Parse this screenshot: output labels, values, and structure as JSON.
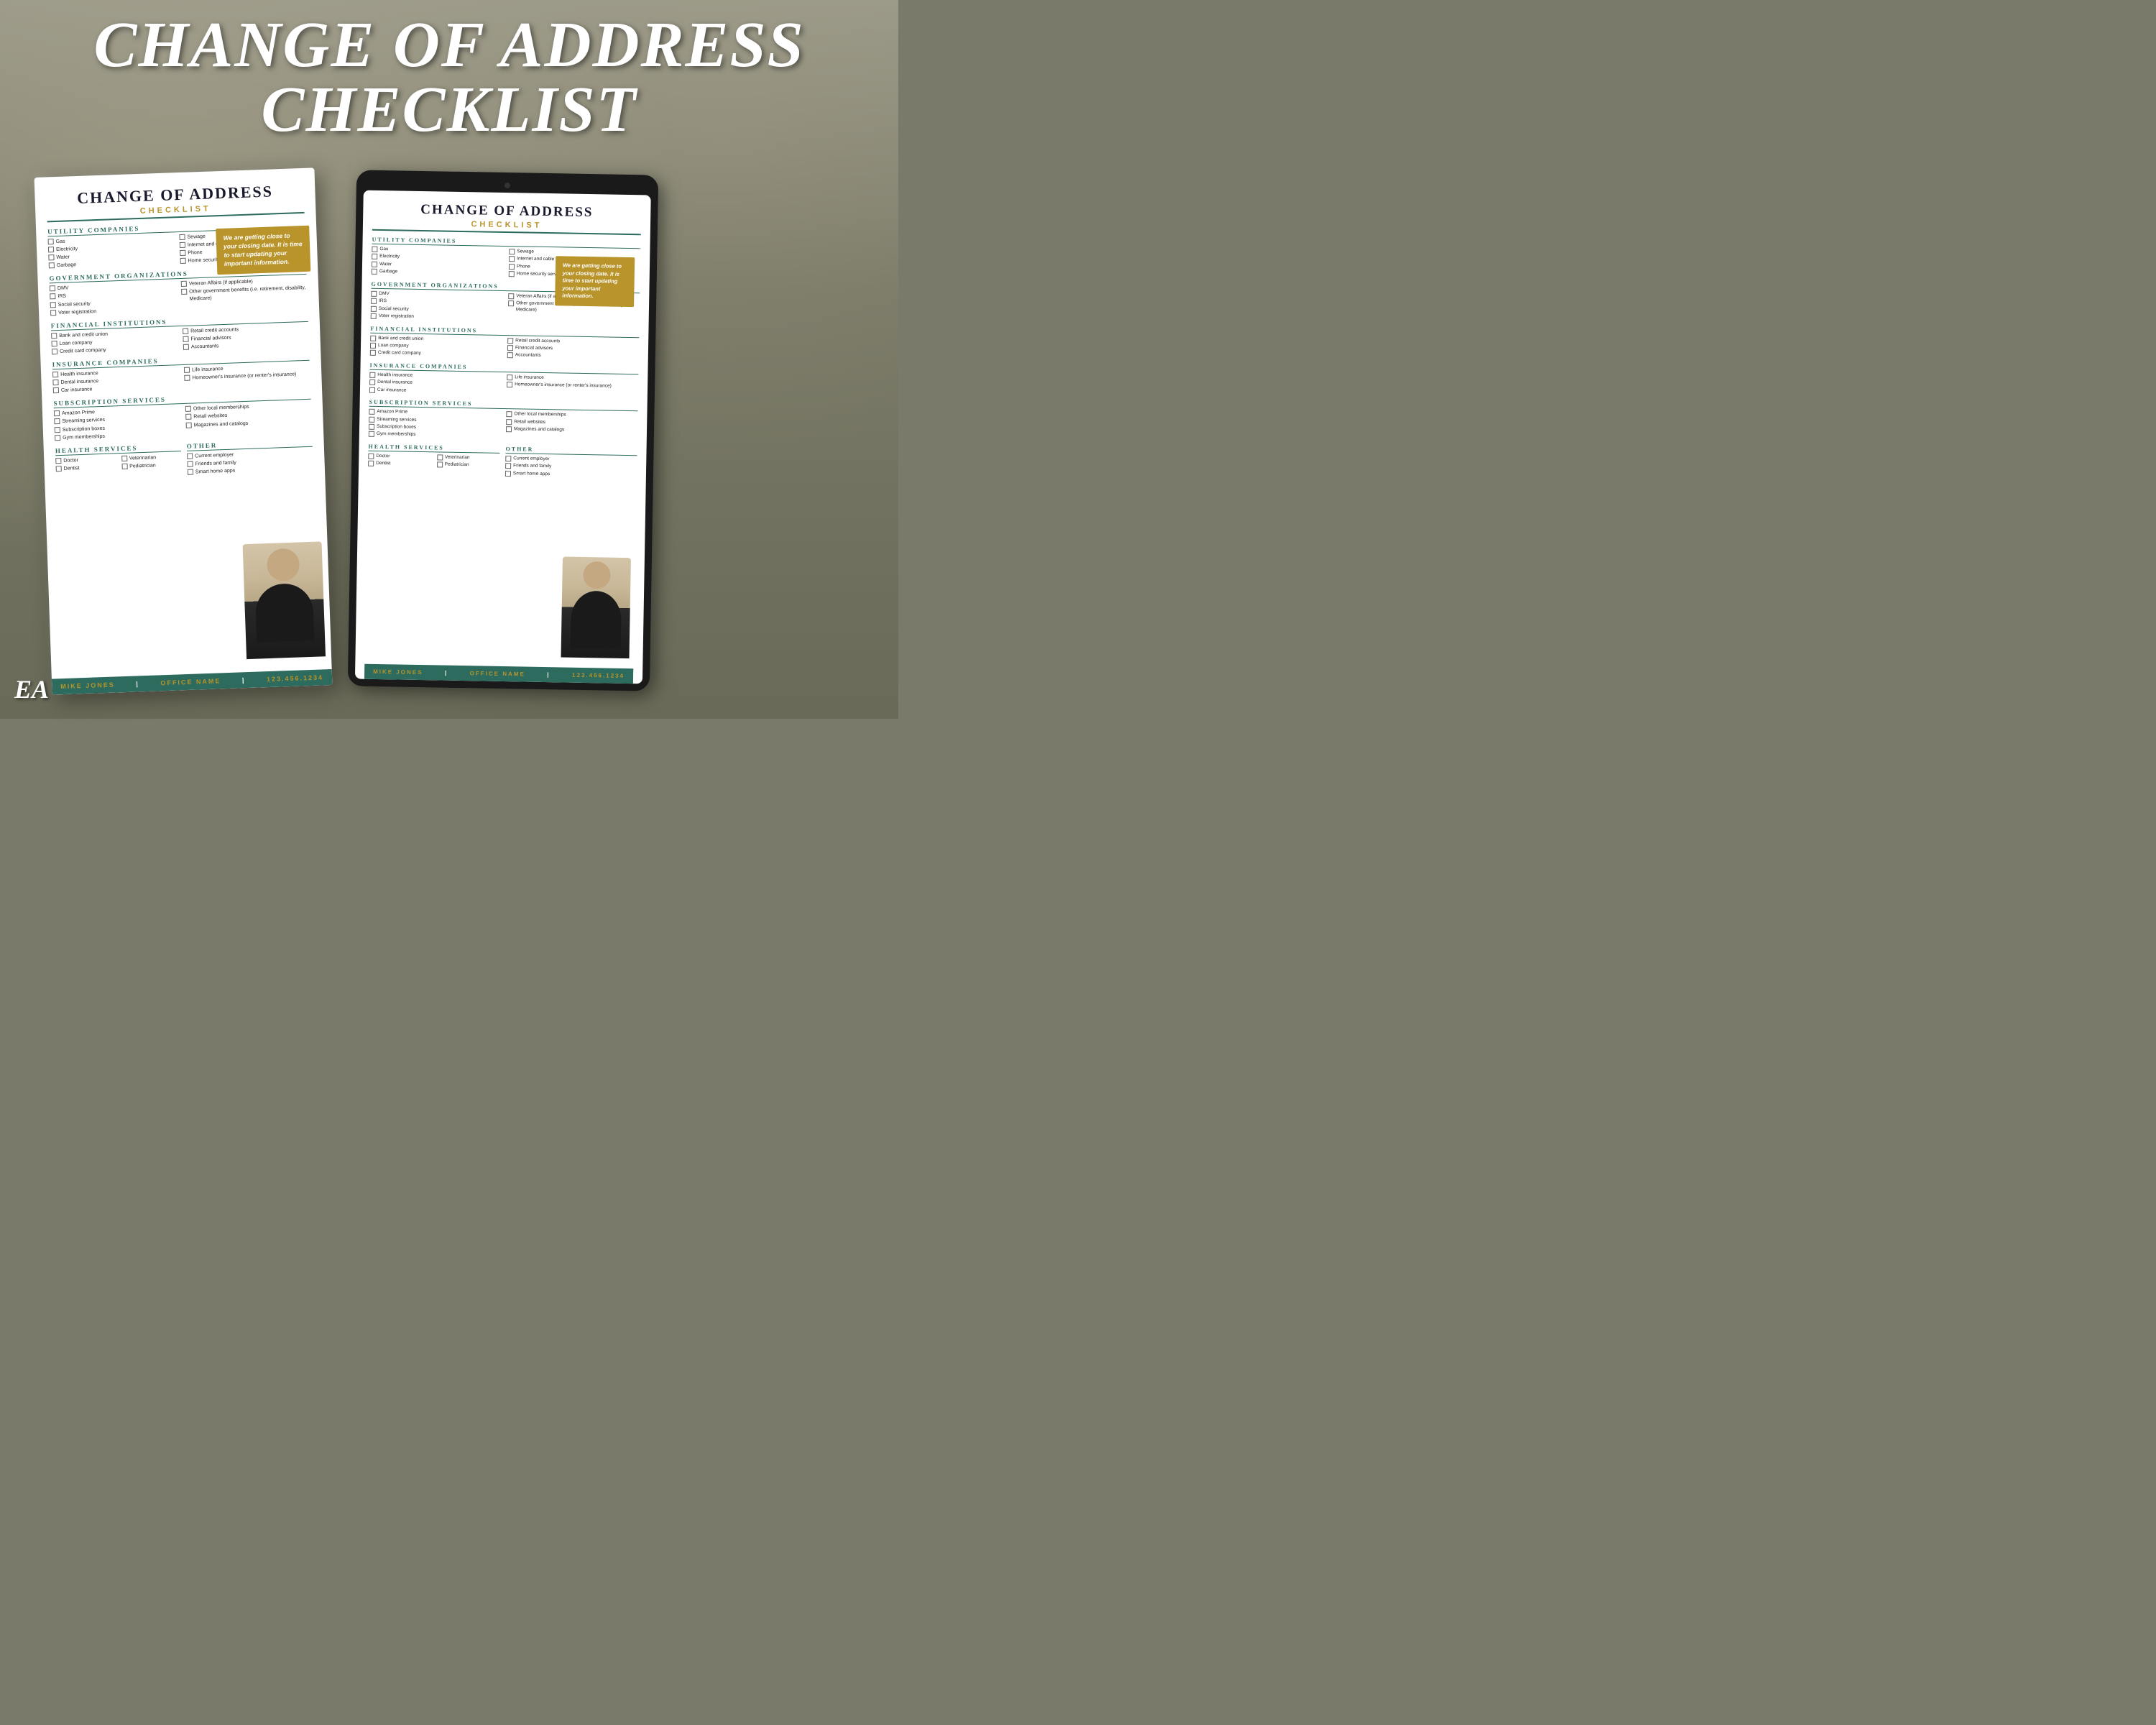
{
  "title": {
    "line1": "CHANGE OF ADDRESS",
    "line2": "CHECKLIST"
  },
  "ea_logo": "EA",
  "document": {
    "title_main": "CHANGE OF ADDRESS",
    "title_sub": "CHECKLIST",
    "gold_box_text": "We are getting close to your closing date. It is time to start updating your important information.",
    "sections": {
      "utility": {
        "title": "UTILITY COMPANIES",
        "col1": [
          "Gas",
          "Electricity",
          "Water",
          "Garbage"
        ],
        "col2": [
          "Sewage",
          "Internet and cable",
          "Phone",
          "Home security service"
        ]
      },
      "government": {
        "title": "GOVERNMENT ORGANIZATIONS",
        "col1": [
          "DMV",
          "IRS",
          "Social security",
          "Voter registration"
        ],
        "col2": [
          "Veteran Affairs (if applicable)",
          "Other government benefits (i.e. retirement, disability, Medicare)"
        ]
      },
      "financial": {
        "title": "FINANCIAL INSTITUTIONS",
        "col1": [
          "Bank and credit union",
          "Loan company",
          "Credit card company"
        ],
        "col2": [
          "Retail credit accounts",
          "Financial advisors",
          "Accountants"
        ]
      },
      "insurance": {
        "title": "INSURANCE COMPANIES",
        "col1": [
          "Health insurance",
          "Dental insurance",
          "Car insurance"
        ],
        "col2": [
          "Life insurance",
          "Homeowner's insurance (or renter's insurance)"
        ]
      },
      "subscription": {
        "title": "SUBSCRIPTION SERVICES",
        "col1": [
          "Amazon Prime",
          "Streaming services",
          "Subscription boxes",
          "Gym memberships"
        ],
        "col2": [
          "Other local memberships",
          "Retail websites",
          "Magazines and catalogs"
        ]
      },
      "health": {
        "title": "HEALTH SERVICES",
        "col1": [
          "Doctor",
          "Dentist"
        ],
        "col2": [
          "Veterinarian",
          "Pediatrician"
        ]
      },
      "other": {
        "title": "OTHER",
        "col1": [
          "Current employer",
          "Friends and family",
          "Smart home apps"
        ]
      }
    },
    "footer": {
      "name": "MIKE JONES",
      "office": "OFFICE NAME",
      "phone": "123.456.1234"
    }
  }
}
